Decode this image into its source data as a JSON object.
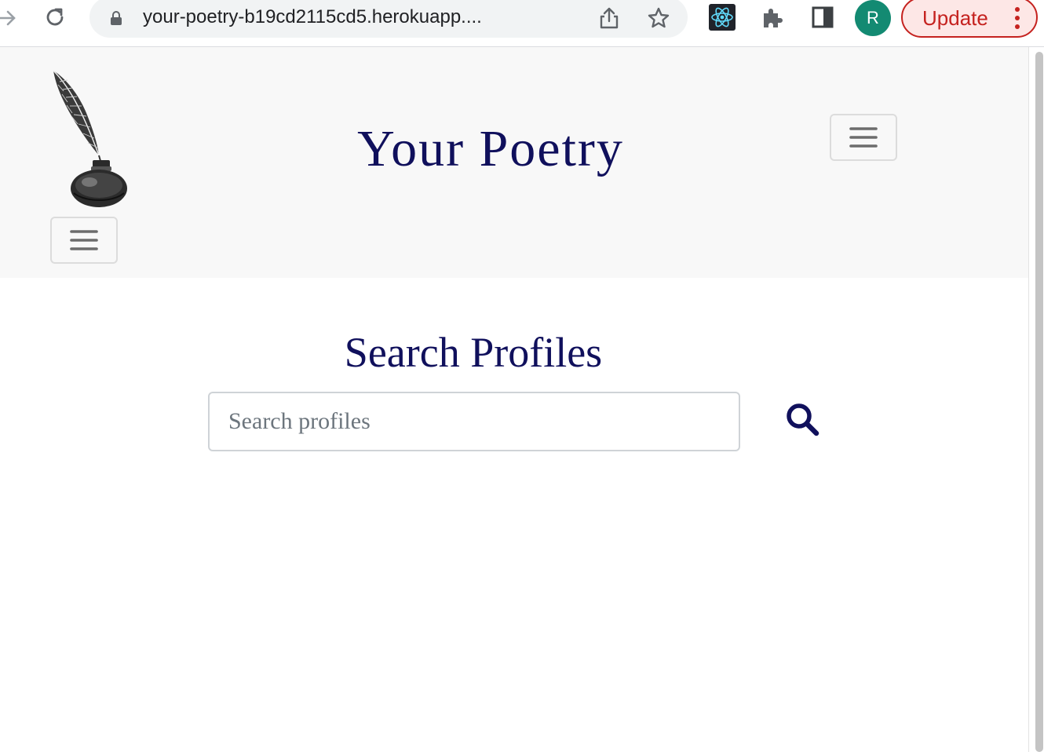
{
  "browser": {
    "url": "your-poetry-b19cd2115cd5.herokuapp....",
    "profile_initial": "R",
    "update_label": "Update",
    "colors": {
      "avatar": "#138a72",
      "update": "#c5221f"
    },
    "icons": [
      "forward-icon",
      "reload-icon",
      "lock-icon",
      "share-icon",
      "star-icon",
      "react-devtools-icon",
      "extensions-icon",
      "side-panel-icon",
      "more-menu-icon"
    ]
  },
  "navbar": {
    "brand": "Your Poetry",
    "logo_icon": "quill-inkwell-logo",
    "colors": {
      "brand": "#10105c",
      "background": "#f8f8f8"
    }
  },
  "main": {
    "title": "Search Profiles",
    "search": {
      "placeholder": "Search profiles",
      "value": ""
    },
    "search_button_icon": "search-icon"
  }
}
